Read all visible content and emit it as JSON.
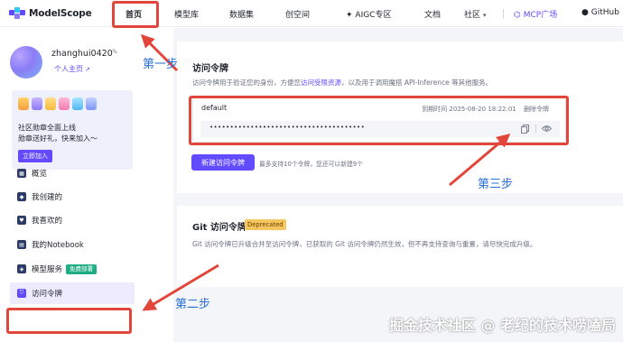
{
  "nav": {
    "logo_text": "ModelScope",
    "items": [
      {
        "label": "首页"
      },
      {
        "label": "模型库"
      },
      {
        "label": "数据集"
      },
      {
        "label": "创空间"
      },
      {
        "label": "AIGC专区"
      },
      {
        "label": "文档"
      },
      {
        "label": "社区"
      },
      {
        "label": "MCP广场"
      },
      {
        "label": "GitHub"
      }
    ]
  },
  "user": {
    "username": "zhanghui0420",
    "homepage_label": "个人主页"
  },
  "promo": {
    "line1": "社区勋章全面上线",
    "line2": "勋章送好礼，快来加入～",
    "button": "立即加入"
  },
  "menu": {
    "items": [
      {
        "label": "概览"
      },
      {
        "label": "我创建的"
      },
      {
        "label": "我喜欢的"
      },
      {
        "label": "我的Notebook"
      },
      {
        "label": "模型服务",
        "tag": "免费部署"
      },
      {
        "label": "访问令牌"
      }
    ]
  },
  "tokens": {
    "title": "访问令牌",
    "desc_pre": "访问令牌用于验证您的身份，方便您",
    "desc_link": "访问受限资源",
    "desc_post": "，以及用于调用魔搭 API-Inference 等其他服务。",
    "token": {
      "name": "default",
      "expire_label": "到期时间 2025-08-20 18:22:01",
      "delete_label": "删除令牌",
      "masked": "••••••••••••••••••••••••••••••••••••••"
    },
    "new_button": "新建访问令牌",
    "limit_note": "最多支持10个令牌，您还可以新建9个"
  },
  "git": {
    "title": "Git 访问令牌",
    "tag": "Deprecated",
    "desc": "Git 访问令牌已升级合并至访问令牌，已获取的 Git 访问令牌仍然生效，但不再支持查询与重置，请尽快完成升级。"
  },
  "annotations": {
    "step1": "第一步",
    "step2": "第二步",
    "step3": "第三步",
    "color": "#e2453a",
    "label_color": "#2a6fd6"
  },
  "watermark": "掘金技术社区 @ 老纪的技术唠嗑局",
  "colors": {
    "brand": "#624aff",
    "free_tag": "#1fae84",
    "deprecated_tag": "#f5c55f"
  }
}
